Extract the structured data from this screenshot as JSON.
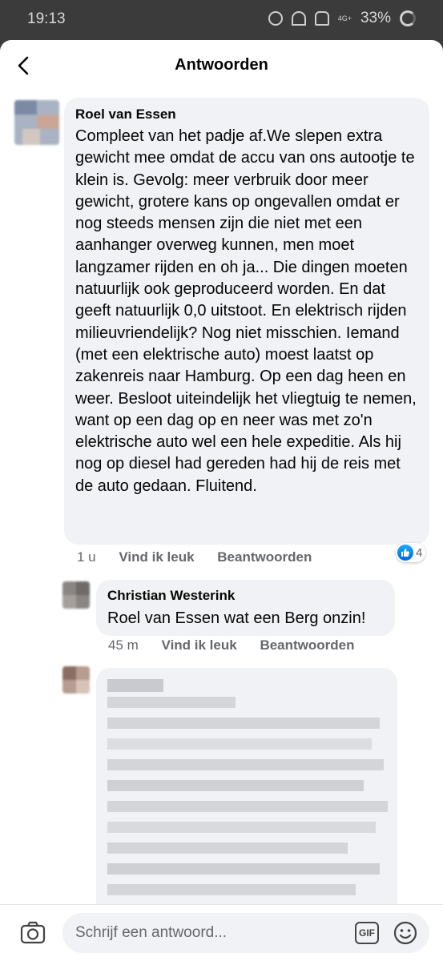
{
  "status_bar": {
    "time": "19:13",
    "network": "4G+",
    "battery": "33%"
  },
  "header": {
    "title": "Antwoorden"
  },
  "comments": [
    {
      "author": "Roel van Essen",
      "text": "Compleet van het padje af.We slepen extra gewicht mee omdat de accu van ons autootje te klein is. Gevolg: meer verbruik door meer gewicht, grotere kans op ongevallen omdat er nog steeds mensen zijn die niet met een aanhanger overweg kunnen, men moet langzamer rijden en oh ja... Die dingen moeten natuurlijk ook geproduceerd worden. En dat geeft natuurlijk 0,0 uitstoot. En elektrisch rijden milieuvriendelijk? Nog niet misschien. Iemand (met een elektrische auto) moest laatst op zakenreis naar Hamburg. Op een dag heen en weer. Besloot uiteindelijk het vliegtuig te nemen, want op een dag op en neer was met zo'n elektrische auto wel een hele expeditie. Als hij nog op diesel had gereden had hij de reis met de auto gedaan. Fluitend.",
      "time": "1 u",
      "like_label": "Vind ik leuk",
      "reply_label": "Beantwoorden",
      "reaction_count": "4",
      "reaction_icon": "like-icon"
    },
    {
      "author": "Christian Westerink",
      "text": "Roel van Essen wat een Berg onzin!",
      "time": "45 m",
      "like_label": "Vind ik leuk",
      "reply_label": "Beantwoorden"
    }
  ],
  "composer": {
    "placeholder": "Schrijf een antwoord...",
    "gif_label": "GIF"
  },
  "colors": {
    "bubble": "#f0f2f5",
    "secondary_text": "#65676b",
    "like_blue": "#0165e1"
  }
}
